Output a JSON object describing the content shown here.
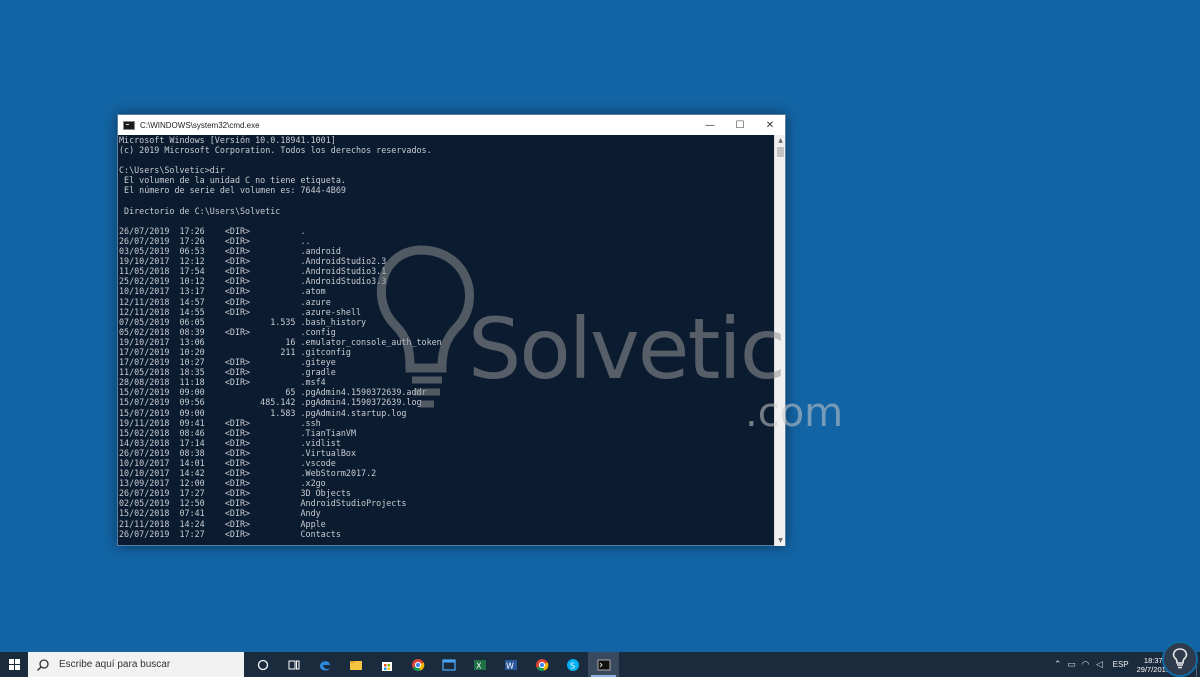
{
  "window": {
    "title": "C:\\WINDOWS\\system32\\cmd.exe",
    "minimize": "—",
    "maximize": "☐",
    "close": "✕"
  },
  "console_lines": [
    "Microsoft Windows [Versión 10.0.18941.1001]",
    "(c) 2019 Microsoft Corporation. Todos los derechos reservados.",
    "",
    "C:\\Users\\Solvetic>dir",
    " El volumen de la unidad C no tiene etiqueta.",
    " El número de serie del volumen es: 7644-4B69",
    "",
    " Directorio de C:\\Users\\Solvetic",
    "",
    "26/07/2019  17:26    <DIR>          .",
    "26/07/2019  17:26    <DIR>          ..",
    "03/05/2019  06:53    <DIR>          .android",
    "19/10/2017  12:12    <DIR>          .AndroidStudio2.3",
    "11/05/2018  17:54    <DIR>          .AndroidStudio3.1",
    "25/02/2019  10:12    <DIR>          .AndroidStudio3.3",
    "10/10/2017  13:17    <DIR>          .atom",
    "12/11/2018  14:57    <DIR>          .azure",
    "12/11/2018  14:55    <DIR>          .azure-shell",
    "07/05/2019  06:05             1.535 .bash_history",
    "05/02/2018  08:39    <DIR>          .config",
    "19/10/2017  13:06                16 .emulator_console_auth_token",
    "17/07/2019  10:20               211 .gitconfig",
    "17/07/2019  10:27    <DIR>          .giteye",
    "11/05/2018  18:35    <DIR>          .gradle",
    "28/08/2018  11:18    <DIR>          .msf4",
    "15/07/2019  09:00                65 .pgAdmin4.1590372639.addr",
    "15/07/2019  09:56           485.142 .pgAdmin4.1590372639.log",
    "15/07/2019  09:00             1.583 .pgAdmin4.startup.log",
    "19/11/2018  09:41    <DIR>          .ssh",
    "15/02/2018  08:46    <DIR>          .TianTianVM",
    "14/03/2018  17:14    <DIR>          .vidlist",
    "26/07/2019  08:38    <DIR>          .VirtualBox",
    "10/10/2017  14:01    <DIR>          .vscode",
    "10/10/2017  14:42    <DIR>          .WebStorm2017.2",
    "13/09/2017  12:00    <DIR>          .x2go",
    "26/07/2019  17:27    <DIR>          3D Objects",
    "02/05/2019  12:50    <DIR>          AndroidStudioProjects",
    "15/02/2018  07:41    <DIR>          Andy",
    "21/11/2018  14:24    <DIR>          Apple",
    "26/07/2019  17:27    <DIR>          Contacts"
  ],
  "watermark": {
    "text": "Solvetic",
    "suffix": ".com"
  },
  "taskbar": {
    "search_placeholder": "Escribe aquí para buscar",
    "apps": [
      "task-view-icon",
      "edge-icon",
      "file-explorer-icon",
      "store-icon",
      "chrome-icon",
      "window-icon",
      "excel-icon",
      "word-icon",
      "chrome-icon",
      "skype-icon",
      "cmd-icon"
    ],
    "language": "ESP",
    "time": "18:37",
    "date": "29/7/2019"
  },
  "colors": {
    "desktop": "#1364a4",
    "console_bg": "#0c1c30",
    "console_text": "#c8ccd2",
    "taskbar": "#1b2b3e"
  }
}
